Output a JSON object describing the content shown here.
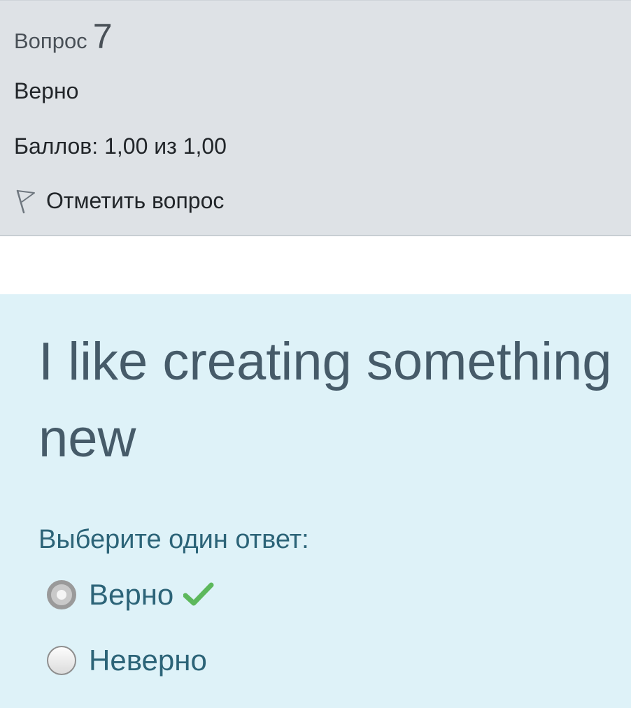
{
  "info": {
    "question_label": "Вопрос",
    "question_number": "7",
    "state": "Верно",
    "grade": "Баллов: 1,00 из 1,00",
    "flag_label": "Отметить вопрос",
    "flag_icon": "flag-outline-icon"
  },
  "question": {
    "text": "I like creating something new",
    "prompt": "Выберите один ответ:",
    "options": [
      {
        "label": "Верно",
        "selected": true,
        "correct": true
      },
      {
        "label": "Неверно",
        "selected": false,
        "correct": false
      }
    ],
    "correct_icon": "checkmark-icon"
  },
  "colors": {
    "info_bg": "#dee2e6",
    "question_bg": "#def2f8",
    "question_text": "#465b69",
    "answer_text": "#2c6478",
    "correct_green": "#5cb85c"
  }
}
